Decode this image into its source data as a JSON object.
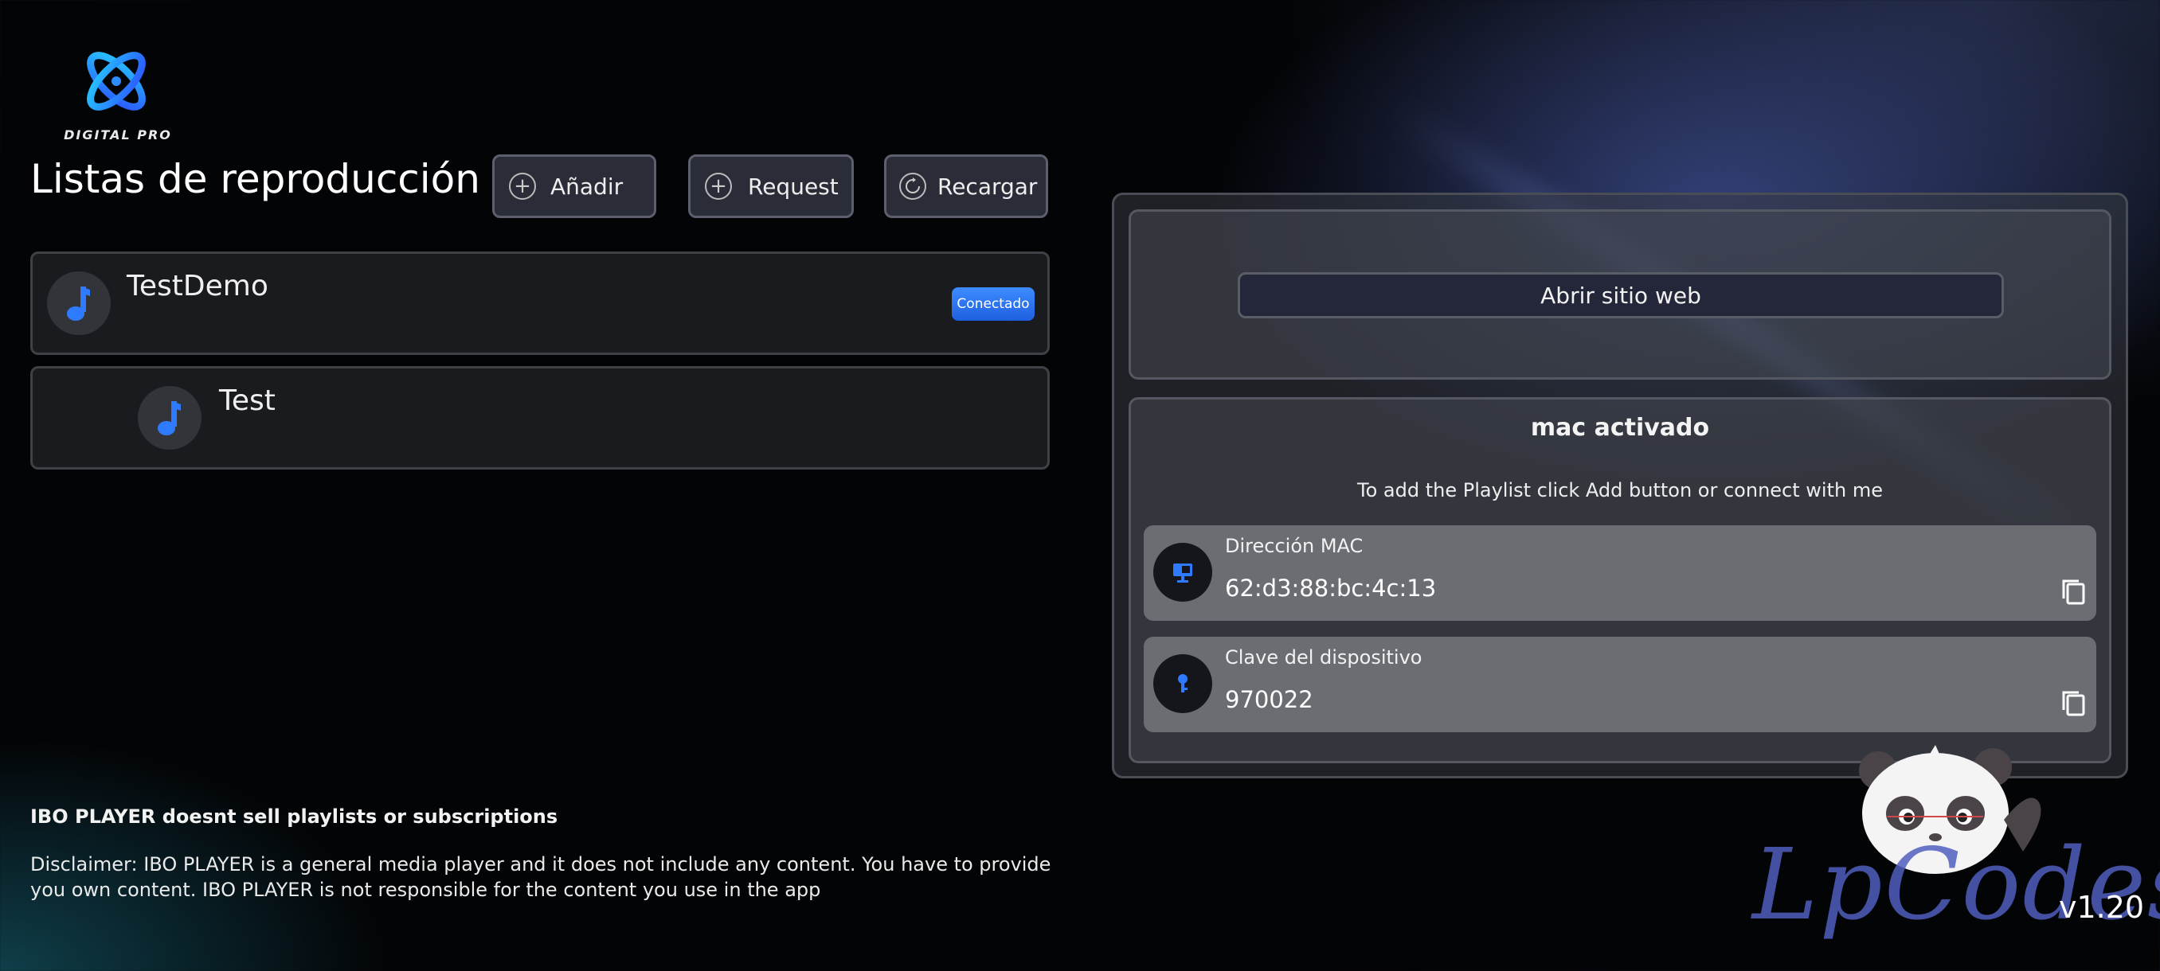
{
  "brand": {
    "logo_text": "DIGITAL PRO"
  },
  "header": {
    "title": "Listas de reproducción"
  },
  "toolbar": {
    "add_label": "Añadir",
    "request_label": "Request",
    "reload_label": "Recargar"
  },
  "playlists": [
    {
      "name": "TestDemo",
      "badge": "Conectado"
    },
    {
      "name": "Test"
    }
  ],
  "panel": {
    "open_site_label": "Abrir sitio web",
    "status_title": "mac activado",
    "hint": "To add the Playlist click Add button or connect with me",
    "mac": {
      "label": "Dirección MAC",
      "value": "62:d3:88:bc:4c:13",
      "icon": "monitor-icon"
    },
    "device_key": {
      "label": "Clave del dispositivo",
      "value": "970022",
      "icon": "key-icon"
    }
  },
  "footer": {
    "title": "IBO PLAYER doesnt sell playlists or subscriptions",
    "disclaimer": "Disclaimer: IBO PLAYER is a general media player and it does not include any content. You have to provide you own content. IBO PLAYER is not responsible for the content you use in the app"
  },
  "watermark": "LpCodes",
  "version": "v1.20",
  "colors": {
    "accent": "#2f7bff",
    "badge": "#2f7bff",
    "panel_border": "#4a4d55"
  }
}
